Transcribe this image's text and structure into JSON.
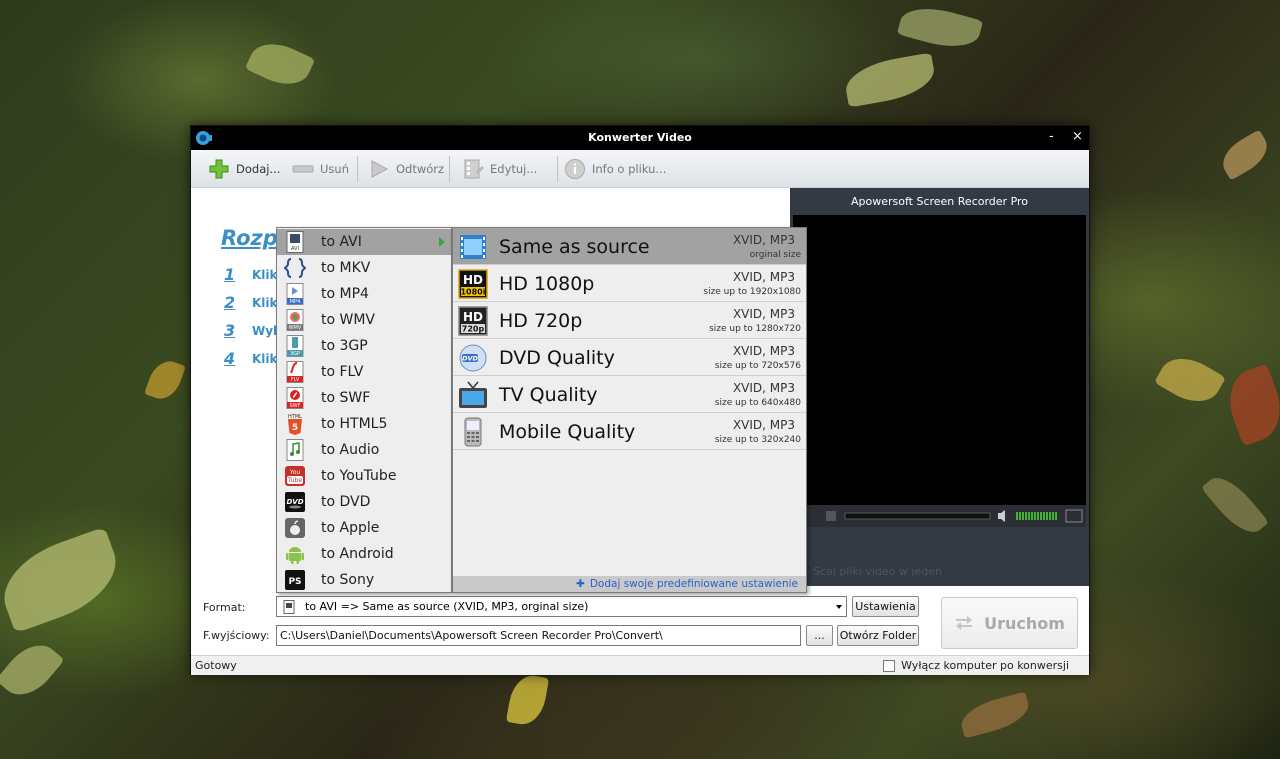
{
  "window": {
    "title": "Konwerter Video",
    "minimize": "-",
    "close": "×"
  },
  "toolbar": {
    "add": "Dodaj...",
    "remove": "Usuń",
    "play": "Odtwórz",
    "edit": "Edytuj...",
    "info": "Info o pliku..."
  },
  "welcome": {
    "title": "Rozp",
    "steps": [
      {
        "num": "1",
        "text": "Klikn"
      },
      {
        "num": "2",
        "text": "Klikn"
      },
      {
        "num": "3",
        "text": "Wyb"
      },
      {
        "num": "4",
        "text": "Klikn"
      }
    ]
  },
  "preview": {
    "title": "Apowersoft Screen Recorder Pro",
    "merge_text": "Scal pliki video w jeden"
  },
  "format_menu": [
    {
      "label": "to AVI",
      "icon": "avi-icon",
      "selected": true
    },
    {
      "label": "to MKV",
      "icon": "mkv-icon"
    },
    {
      "label": "to MP4",
      "icon": "mp4-icon"
    },
    {
      "label": "to WMV",
      "icon": "wmv-icon"
    },
    {
      "label": "to 3GP",
      "icon": "3gp-icon"
    },
    {
      "label": "to FLV",
      "icon": "flv-icon"
    },
    {
      "label": "to SWF",
      "icon": "swf-icon"
    },
    {
      "label": "to HTML5",
      "icon": "html5-icon"
    },
    {
      "label": "to Audio",
      "icon": "audio-icon"
    },
    {
      "label": "to YouTube",
      "icon": "youtube-icon"
    },
    {
      "label": "to DVD",
      "icon": "dvd-icon"
    },
    {
      "label": "to Apple",
      "icon": "apple-icon"
    },
    {
      "label": "to Android",
      "icon": "android-icon"
    },
    {
      "label": "to Sony",
      "icon": "sony-icon"
    }
  ],
  "icon_text": {
    "avi": "AVI",
    "mp4": "MP4",
    "wmv": "WMV",
    "3gp": "3GP",
    "flv": "FLV",
    "swf": "SWF",
    "html5": "HTML",
    "youtube_top": "You",
    "youtube_bottom": "Tube",
    "dvd": "DVD",
    "sony": "PS",
    "hd": "HD",
    "hd1080": "1080i",
    "hd720": "720p",
    "dvd_disc": "DVD"
  },
  "quality_menu": [
    {
      "name": "Same as source",
      "codec": "XVID, MP3",
      "size": "orginal size",
      "selected": true
    },
    {
      "name": "HD 1080p",
      "codec": "XVID, MP3",
      "size": "size up to 1920x1080"
    },
    {
      "name": "HD 720p",
      "codec": "XVID, MP3",
      "size": "size up to 1280x720"
    },
    {
      "name": "DVD Quality",
      "codec": "XVID, MP3",
      "size": "size up to 720x576"
    },
    {
      "name": "TV Quality",
      "codec": "XVID, MP3",
      "size": "size up to 640x480"
    },
    {
      "name": "Mobile Quality",
      "codec": "XVID, MP3",
      "size": "size up to 320x240"
    }
  ],
  "custom_presets": "Dodaj swoje predefiniowane ustawienie",
  "form": {
    "format_label": "Format:",
    "format_value": "to AVI => Same as source (XVID, MP3, orginal size)",
    "settings_button": "Ustawienia",
    "output_label": "F.wyjściowy:",
    "output_value": "C:\\Users\\Daniel\\Documents\\Apowersoft Screen Recorder Pro\\Convert\\",
    "browse_button": "...",
    "open_folder_button": "Otwórz Folder",
    "run_button": "Uruchom"
  },
  "status": {
    "text": "Gotowy",
    "shutdown_label": "Wyłącz komputer po konwersji"
  },
  "colors": {
    "accent_link": "#3b8fc4",
    "menu_selected": "#a2a2a2",
    "preset_link": "#2a5fcf"
  }
}
